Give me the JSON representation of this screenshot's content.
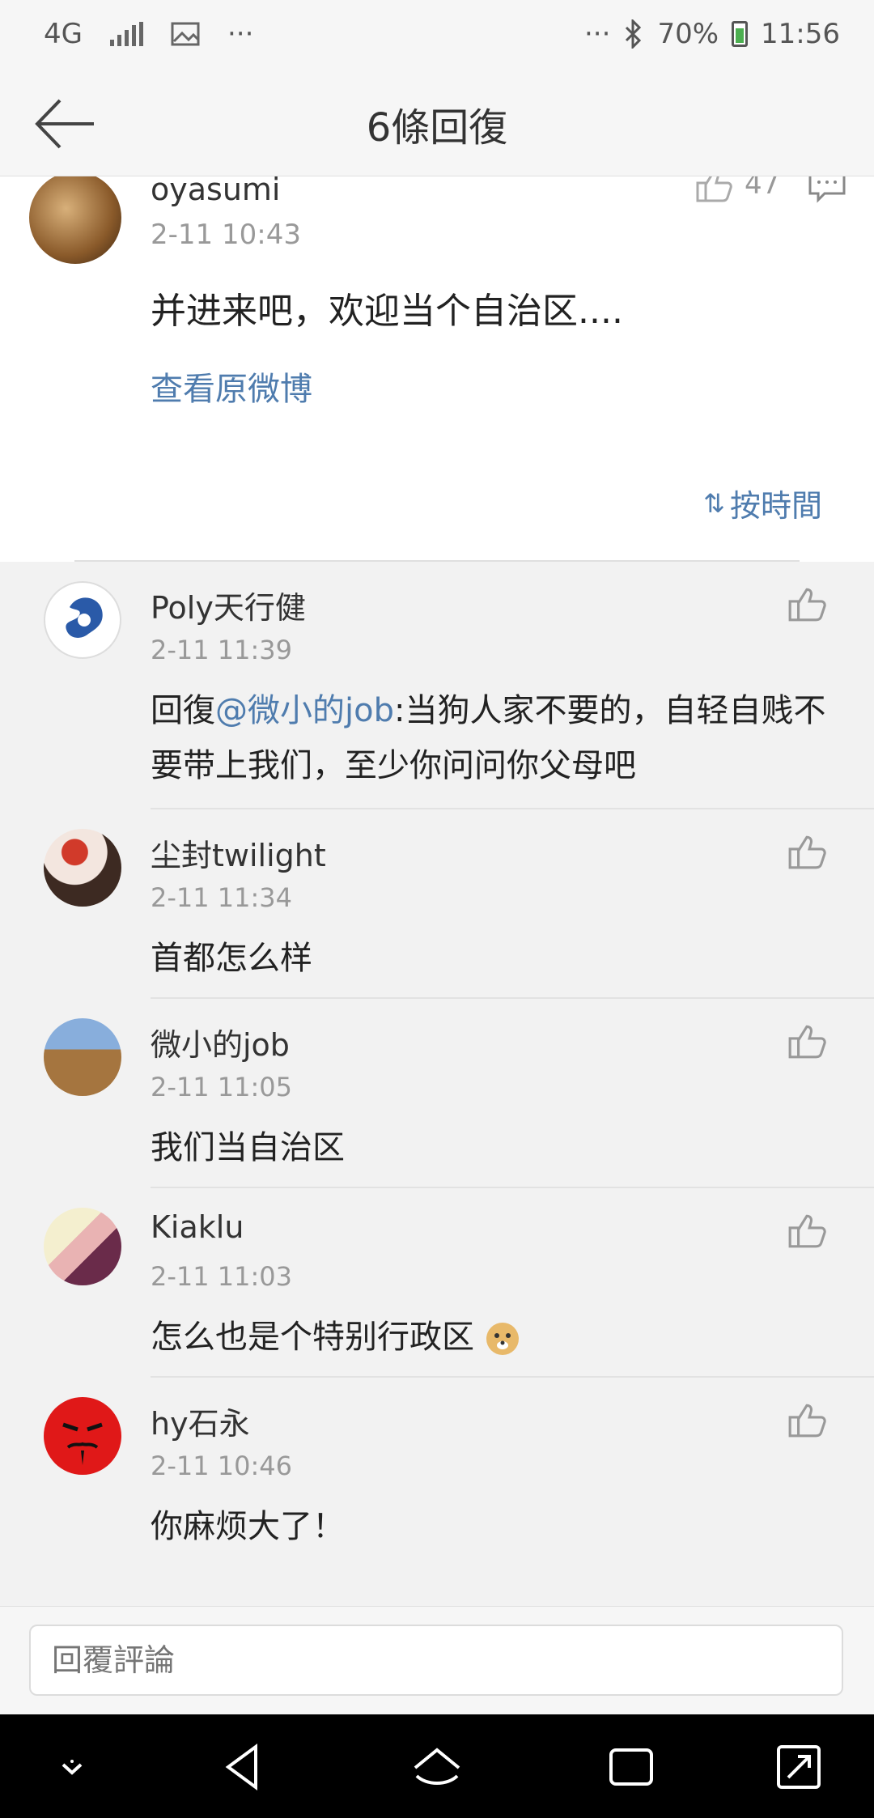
{
  "status_bar": {
    "network": "4G",
    "more": "···",
    "more_right": "···",
    "battery": "70%",
    "time": "11:56"
  },
  "header": {
    "title": "6條回復"
  },
  "origin": {
    "user": "oyasumi",
    "time": "2-11 10:43",
    "text": "并进来吧，欢迎当个自治区....",
    "link": "查看原微博",
    "like_count": "47",
    "sort_label": "按時間"
  },
  "replies": [
    {
      "user": "Poly天行健",
      "time": "2-11 11:39",
      "prefix": "回復",
      "mention": "@微小的job",
      "text": ":当狗人家不要的，自轻自贱不要带上我们，至少你问问你父母吧"
    },
    {
      "user": "尘封twilight",
      "time": "2-11 11:34",
      "text": "首都怎么样"
    },
    {
      "user": "微小的job",
      "time": "2-11 11:05",
      "text": "我们当自治区"
    },
    {
      "user": "Kiaklu",
      "time": "2-11 11:03",
      "text": "怎么也是个特别行政区"
    },
    {
      "user": "hy石永",
      "time": "2-11 10:46",
      "text": "你麻烦大了！"
    }
  ],
  "reply_bar": {
    "placeholder": "回覆評論"
  },
  "colors": {
    "link": "#4f7cae",
    "muted": "#999999",
    "list_bg": "#f2f2f2"
  }
}
